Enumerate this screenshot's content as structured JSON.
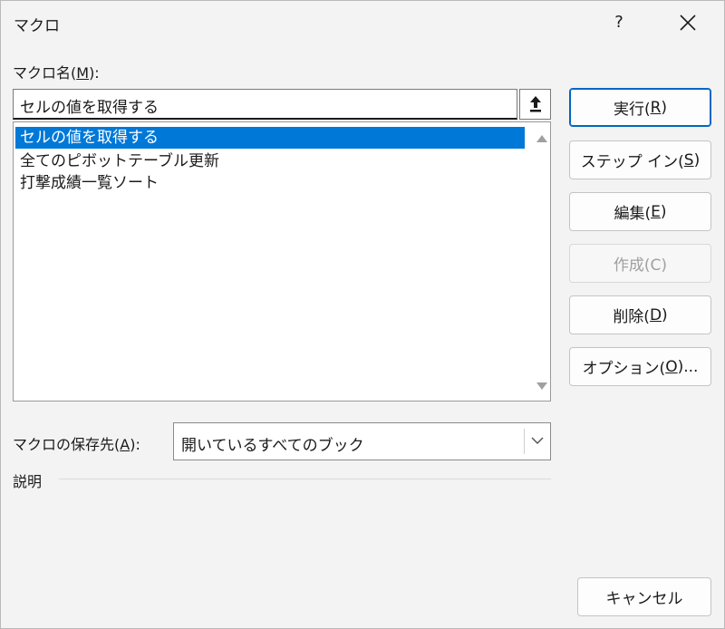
{
  "title": "マクロ",
  "help_label": "?",
  "macro_name": {
    "label_pre": "マクロ名(",
    "accel": "M",
    "label_post": "):",
    "value": "セルの値を取得する"
  },
  "macro_list": {
    "items": [
      {
        "label": "セルの値を取得する",
        "selected": true
      },
      {
        "label": "全てのピボットテーブル更新",
        "selected": false
      },
      {
        "label": "打撃成績一覧ソート",
        "selected": false
      }
    ]
  },
  "buttons": {
    "run": {
      "pre": "実行(",
      "accel": "R",
      "post": ")"
    },
    "step_in": {
      "pre": "ステップ イン(",
      "accel": "S",
      "post": ")"
    },
    "edit": {
      "pre": "編集(",
      "accel": "E",
      "post": ")"
    },
    "create": {
      "label": "作成(C)"
    },
    "delete": {
      "pre": "削除(",
      "accel": "D",
      "post": ")"
    },
    "options": {
      "pre": "オプション(",
      "accel": "O",
      "post": ")..."
    },
    "cancel": {
      "label": "キャンセル"
    }
  },
  "store_in": {
    "label_pre": "マクロの保存先(",
    "accel": "A",
    "label_post": "):",
    "value": "開いているすべてのブック"
  },
  "description": {
    "label": "説明"
  },
  "colors": {
    "selection": "#0078d7",
    "default_border": "#0067c0"
  }
}
